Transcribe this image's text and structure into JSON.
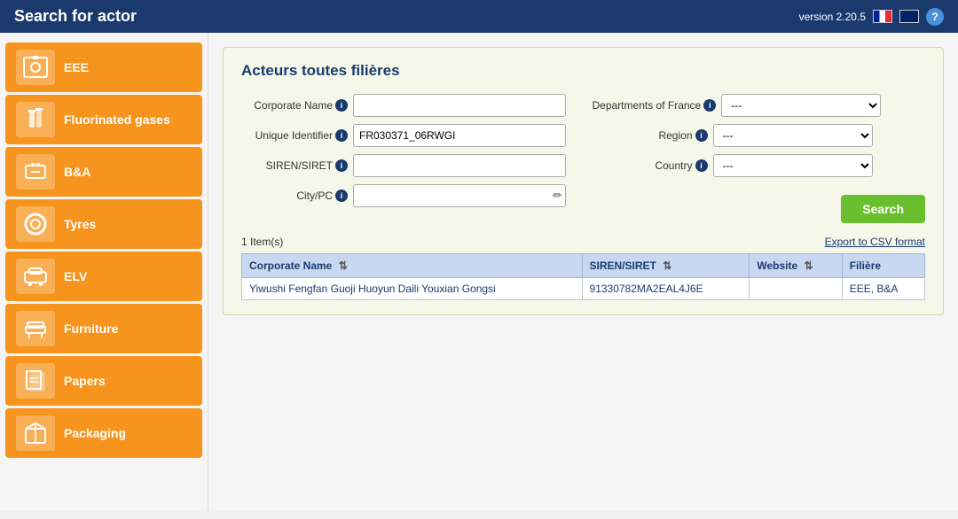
{
  "header": {
    "title": "Search for actor",
    "version": "version 2.20.5",
    "help_label": "?"
  },
  "sidebar": {
    "items": [
      {
        "id": "eee",
        "label": "EEE",
        "icon": "washing-machine"
      },
      {
        "id": "fluorinated-gases",
        "label": "Fluorinated gases",
        "icon": "gas-cylinder"
      },
      {
        "id": "bna",
        "label": "B&A",
        "icon": "battery"
      },
      {
        "id": "tyres",
        "label": "Tyres",
        "icon": "tyre"
      },
      {
        "id": "elv",
        "label": "ELV",
        "icon": "car-seat"
      },
      {
        "id": "furniture",
        "label": "Furniture",
        "icon": "furniture"
      },
      {
        "id": "papers",
        "label": "Papers",
        "icon": "papers"
      },
      {
        "id": "packaging",
        "label": "Packaging",
        "icon": "packaging"
      }
    ]
  },
  "content": {
    "section_title": "Acteurs toutes filières",
    "form": {
      "corporate_name_label": "Corporate Name",
      "unique_identifier_label": "Unique Identifier",
      "siren_siret_label": "SIREN/SIRET",
      "city_pc_label": "City/PC",
      "departments_of_france_label": "Departments of France",
      "region_label": "Region",
      "country_label": "Country",
      "unique_identifier_value": "FR030371_06RWGI",
      "departments_placeholder": "---",
      "region_placeholder": "---",
      "country_placeholder": "---",
      "search_button_label": "Search"
    },
    "results": {
      "count_text": "1 Item(s)",
      "export_label": "Export to CSV format",
      "table": {
        "columns": [
          {
            "id": "corporate_name",
            "label": "Corporate Name"
          },
          {
            "id": "siren_siret",
            "label": "SIREN/SIRET"
          },
          {
            "id": "website",
            "label": "Website"
          },
          {
            "id": "filiere",
            "label": "Filière"
          }
        ],
        "rows": [
          {
            "corporate_name": "Yiwushi Fengfan Guoji Huoyun Daili Youxian Gongsi",
            "siren_siret": "91330782MA2EAL4J6E",
            "website": "",
            "filiere": "EEE, B&A"
          }
        ]
      }
    }
  }
}
